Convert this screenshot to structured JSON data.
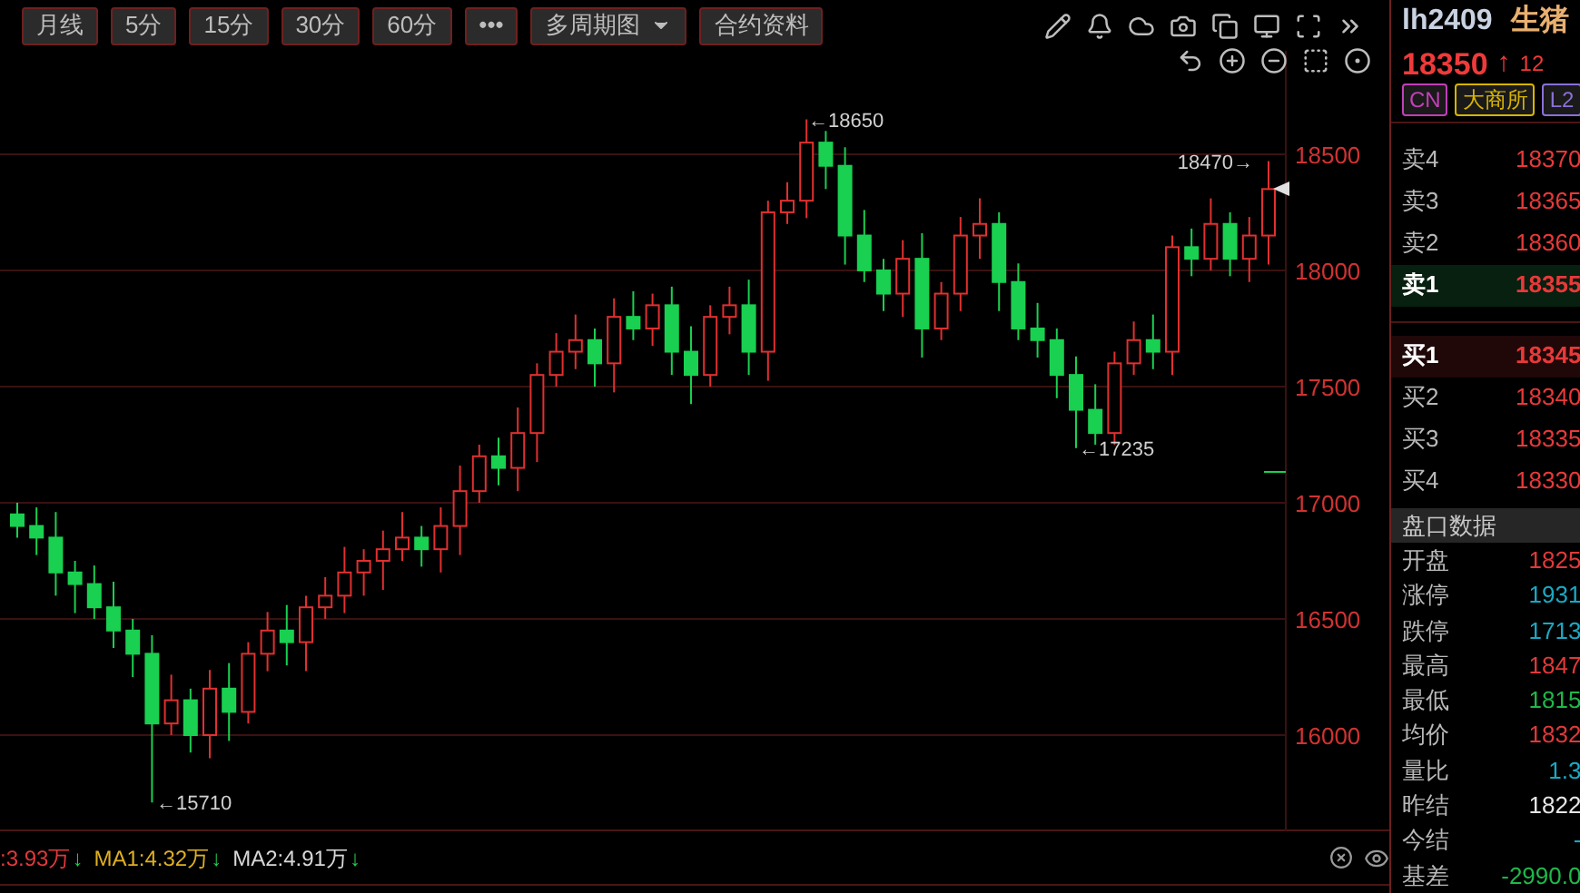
{
  "toolbar": {
    "buttons": [
      {
        "label": "月线",
        "kind": "text"
      },
      {
        "label": "5分",
        "kind": "text"
      },
      {
        "label": "15分",
        "kind": "text"
      },
      {
        "label": "30分",
        "kind": "text"
      },
      {
        "label": "60分",
        "kind": "text"
      },
      {
        "label": "•••",
        "kind": "text"
      },
      {
        "label": "多周期图",
        "kind": "dropdown"
      },
      {
        "label": "合约资料",
        "kind": "text"
      }
    ]
  },
  "chart": {
    "chart_data": {
      "type": "candlestick",
      "ylim": [
        15586,
        18945
      ],
      "grid": true,
      "yticks": [
        18500,
        18000,
        17500,
        17000,
        16500,
        16000
      ],
      "ohlc": [
        [
          16950,
          17000,
          16850,
          16900
        ],
        [
          16900,
          16980,
          16775,
          16850
        ],
        [
          16850,
          16960,
          16600,
          16700
        ],
        [
          16700,
          16750,
          16525,
          16650
        ],
        [
          16650,
          16730,
          16500,
          16550
        ],
        [
          16550,
          16660,
          16375,
          16450
        ],
        [
          16450,
          16500,
          16250,
          16350
        ],
        [
          16350,
          16430,
          15710,
          16050
        ],
        [
          16050,
          16260,
          16000,
          16150
        ],
        [
          16150,
          16200,
          15925,
          16000
        ],
        [
          16000,
          16280,
          15900,
          16200
        ],
        [
          16200,
          16310,
          15975,
          16100
        ],
        [
          16100,
          16400,
          16050,
          16350
        ],
        [
          16350,
          16530,
          16275,
          16450
        ],
        [
          16450,
          16560,
          16300,
          16400
        ],
        [
          16400,
          16600,
          16275,
          16550
        ],
        [
          16550,
          16680,
          16500,
          16600
        ],
        [
          16600,
          16810,
          16525,
          16700
        ],
        [
          16700,
          16800,
          16600,
          16750
        ],
        [
          16750,
          16880,
          16625,
          16800
        ],
        [
          16800,
          16960,
          16750,
          16850
        ],
        [
          16850,
          16900,
          16725,
          16800
        ],
        [
          16800,
          16980,
          16700,
          16900
        ],
        [
          16900,
          17160,
          16775,
          17050
        ],
        [
          17050,
          17250,
          17000,
          17200
        ],
        [
          17200,
          17280,
          17075,
          17150
        ],
        [
          17150,
          17410,
          17050,
          17300
        ],
        [
          17300,
          17600,
          17175,
          17550
        ],
        [
          17550,
          17730,
          17500,
          17650
        ],
        [
          17650,
          17810,
          17575,
          17700
        ],
        [
          17700,
          17750,
          17500,
          17600
        ],
        [
          17600,
          17880,
          17475,
          17800
        ],
        [
          17800,
          17910,
          17700,
          17750
        ],
        [
          17750,
          17900,
          17675,
          17850
        ],
        [
          17850,
          17930,
          17550,
          17650
        ],
        [
          17650,
          17760,
          17425,
          17550
        ],
        [
          17550,
          17850,
          17500,
          17800
        ],
        [
          17800,
          17930,
          17725,
          17850
        ],
        [
          17850,
          17960,
          17550,
          17650
        ],
        [
          17650,
          18300,
          17525,
          18250
        ],
        [
          18250,
          18380,
          18200,
          18300
        ],
        [
          18300,
          18650,
          18225,
          18550
        ],
        [
          18550,
          18600,
          18350,
          18450
        ],
        [
          18450,
          18530,
          18025,
          18150
        ],
        [
          18150,
          18260,
          17950,
          18000
        ],
        [
          18000,
          18050,
          17825,
          17900
        ],
        [
          17900,
          18130,
          17800,
          18050
        ],
        [
          18050,
          18160,
          17625,
          17750
        ],
        [
          17750,
          17950,
          17700,
          17900
        ],
        [
          17900,
          18230,
          17825,
          18150
        ],
        [
          18150,
          18310,
          18050,
          18200
        ],
        [
          18200,
          18250,
          17825,
          17950
        ],
        [
          17950,
          18030,
          17700,
          17750
        ],
        [
          17750,
          17860,
          17625,
          17700
        ],
        [
          17700,
          17750,
          17450,
          17550
        ],
        [
          17550,
          17630,
          17235,
          17400
        ],
        [
          17400,
          17510,
          17250,
          17300
        ],
        [
          17300,
          17650,
          17250,
          17600
        ],
        [
          17600,
          17780,
          17550,
          17700
        ],
        [
          17700,
          17810,
          17575,
          17650
        ],
        [
          17650,
          18150,
          17550,
          18100
        ],
        [
          18100,
          18180,
          17975,
          18050
        ],
        [
          18050,
          18310,
          18000,
          18200
        ],
        [
          18200,
          18250,
          17975,
          18050
        ],
        [
          18050,
          18230,
          17950,
          18150
        ],
        [
          18150,
          18470,
          18025,
          18350
        ]
      ]
    },
    "annotations": [
      {
        "text": "←18650",
        "kind": "right"
      },
      {
        "text": "18470→",
        "kind": "left"
      },
      {
        "text": "←17235",
        "kind": "right"
      },
      {
        "text": "←15710",
        "kind": "right"
      }
    ]
  },
  "volume_legend": [
    {
      "text": ":3.93万",
      "color": "#e0393a",
      "arrow": "↓"
    },
    {
      "text": "MA1:4.32万",
      "color": "#e0b020",
      "arrow": "↓"
    },
    {
      "text": "MA2:4.91万",
      "color": "#d8d8d8",
      "arrow": "↓"
    }
  ],
  "quote": {
    "symbol": "lh2409",
    "name": "生猪",
    "price": "18350",
    "arrow": "↑",
    "change": "12",
    "tags": [
      {
        "label": "CN",
        "color": "#c040b8"
      },
      {
        "label": "大商所",
        "color": "#d8b400"
      },
      {
        "label": "L2",
        "color": "#8a70d8"
      }
    ],
    "asks": [
      {
        "label": "卖4",
        "price": "18370",
        "highlighted": false
      },
      {
        "label": "卖3",
        "price": "18365",
        "highlighted": false
      },
      {
        "label": "卖2",
        "price": "18360",
        "highlighted": false
      },
      {
        "label": "卖1",
        "price": "18355",
        "highlighted": true
      }
    ],
    "bids": [
      {
        "label": "买1",
        "price": "18345",
        "highlighted": true
      },
      {
        "label": "买2",
        "price": "18340",
        "highlighted": false
      },
      {
        "label": "买3",
        "price": "18335",
        "highlighted": false
      },
      {
        "label": "买4",
        "price": "18330",
        "highlighted": false
      }
    ],
    "section_title": "盘口数据",
    "stats": [
      {
        "label": "开盘",
        "value": "1825",
        "color": "#e0393a"
      },
      {
        "label": "涨停",
        "value": "1931",
        "color": "#1aa8c4"
      },
      {
        "label": "跌停",
        "value": "1713",
        "color": "#1aa8c4"
      },
      {
        "label": "最高",
        "value": "1847",
        "color": "#e0393a"
      },
      {
        "label": "最低",
        "value": "1815",
        "color": "#1fb84a"
      },
      {
        "label": "均价",
        "value": "1832",
        "color": "#e0393a"
      },
      {
        "label": "量比",
        "value": "1.3",
        "color": "#1aa8c4"
      },
      {
        "label": "昨结",
        "value": "1822",
        "color": "#e6e6e6"
      },
      {
        "label": "今结",
        "value": "-",
        "color": "#1aa8c4"
      },
      {
        "label": "基差",
        "value": "-2990.0",
        "color": "#1fb84a"
      }
    ]
  }
}
